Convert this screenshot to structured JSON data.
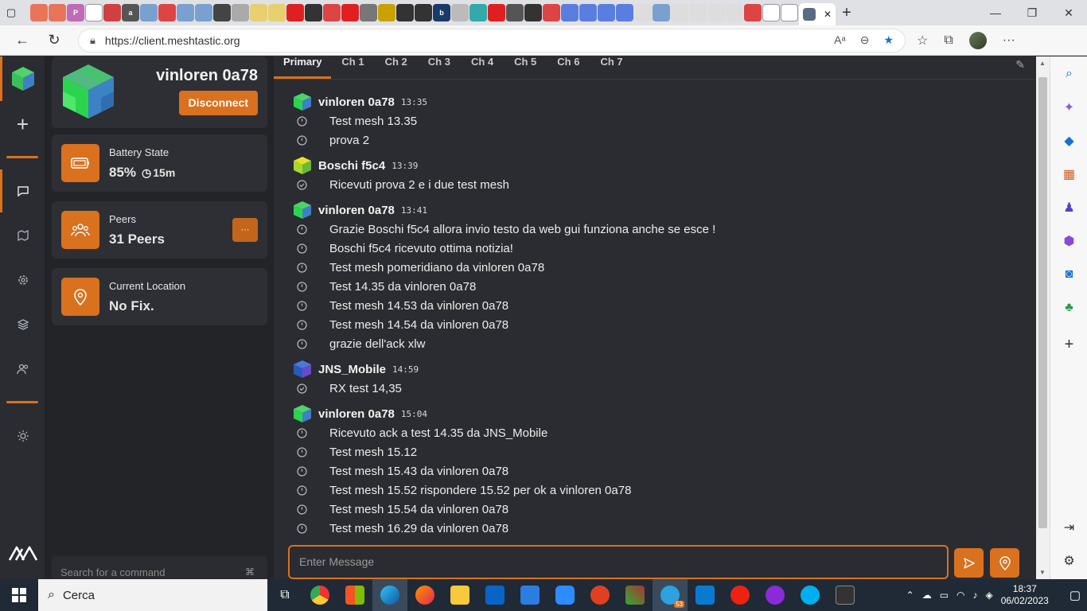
{
  "browser": {
    "url": "https://client.meshtastic.org",
    "tab_close_label": "✕",
    "new_tab_label": "+"
  },
  "sidebar": {
    "node_name": "vinloren 0a78",
    "disconnect_label": "Disconnect",
    "battery": {
      "label": "Battery State",
      "value": "85%",
      "time": "15m"
    },
    "peers": {
      "label": "Peers",
      "value": "31 Peers",
      "more": "···"
    },
    "location": {
      "label": "Current Location",
      "value": "No Fix."
    },
    "search_placeholder": "Search for a command"
  },
  "channels": {
    "tabs": [
      "Primary",
      "Ch 1",
      "Ch 2",
      "Ch 3",
      "Ch 4",
      "Ch 5",
      "Ch 6",
      "Ch 7"
    ],
    "active": "Primary"
  },
  "messages": [
    {
      "sender": "vinloren 0a78",
      "time": "13:35",
      "avatar": "green",
      "lines": [
        {
          "status": "pending",
          "text": "Test mesh 13.35"
        },
        {
          "status": "pending",
          "text": "prova 2"
        }
      ]
    },
    {
      "sender": "Boschi f5c4",
      "time": "13:39",
      "avatar": "yellow",
      "lines": [
        {
          "status": "acked",
          "text": "Ricevuti prova 2 e i due test mesh"
        }
      ]
    },
    {
      "sender": "vinloren 0a78",
      "time": "13:41",
      "avatar": "green",
      "lines": [
        {
          "status": "pending",
          "text": "Grazie Boschi f5c4 allora invio testo da web gui funziona anche se esce !"
        },
        {
          "status": "pending",
          "text": "Boschi f5c4 ricevuto ottima notizia!"
        },
        {
          "status": "pending",
          "text": "Test mesh pomeridiano da vinloren 0a78"
        },
        {
          "status": "pending",
          "text": "Test 14.35 da vinloren 0a78"
        },
        {
          "status": "pending",
          "text": "Test mesh 14.53 da vinloren 0a78"
        },
        {
          "status": "pending",
          "text": "Test mesh 14.54 da vinloren 0a78"
        },
        {
          "status": "pending",
          "text": "grazie dell'ack xlw"
        }
      ]
    },
    {
      "sender": "JNS_Mobile",
      "time": "14:59",
      "avatar": "blue",
      "lines": [
        {
          "status": "acked",
          "text": "RX test 14,35"
        }
      ]
    },
    {
      "sender": "vinloren 0a78",
      "time": "15:04",
      "avatar": "green",
      "lines": [
        {
          "status": "pending",
          "text": "Ricevuto ack a test 14.35 da JNS_Mobile"
        },
        {
          "status": "pending",
          "text": "Test mesh 15.12"
        },
        {
          "status": "pending",
          "text": "Test mesh 15.43 da vinloren 0a78"
        },
        {
          "status": "pending",
          "text": "Test mesh 15.52 rispondere 15.52 per ok a vinloren 0a78"
        },
        {
          "status": "pending",
          "text": "Test mesh 15.54 da vinloren 0a78"
        },
        {
          "status": "pending",
          "text": "Test mesh 16.29 da vinloren 0a78"
        }
      ]
    }
  ],
  "composer": {
    "placeholder": "Enter Message"
  },
  "taskbar": {
    "search_label": "Cerca",
    "time": "18:37",
    "date": "06/02/2023",
    "telegram_badge": "53"
  },
  "colors": {
    "accent": "#d9711e",
    "background": "#2b2c31",
    "panel": "#232427"
  }
}
